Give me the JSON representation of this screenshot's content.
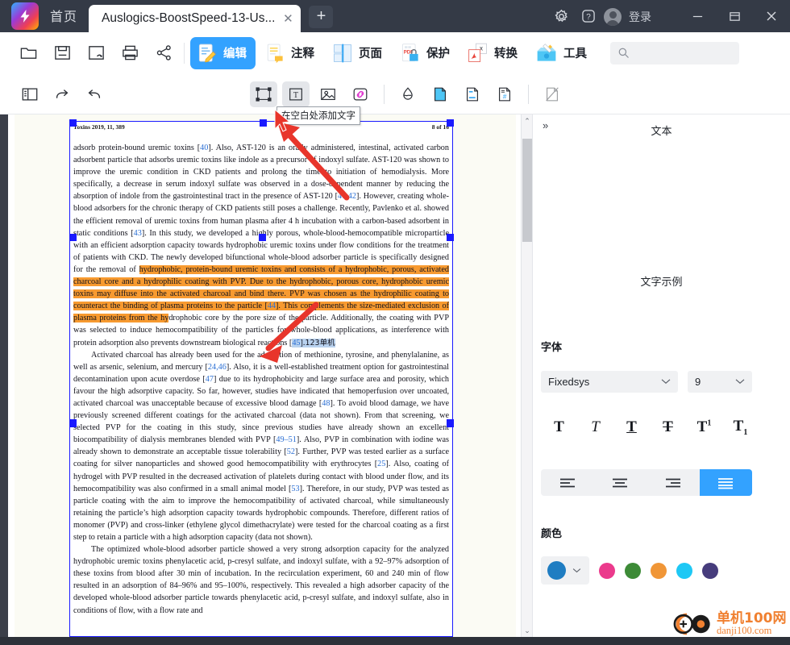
{
  "titlebar": {
    "home_tab": "首页",
    "doc_tab_title": "Auslogics-BoostSpeed-13-Us...",
    "close_tab": "✕",
    "new_tab": "+",
    "settings_icon": "gear-icon",
    "help_icon": "question-mark-icon",
    "login_label": "登录",
    "minimize": "—",
    "restore": "❐",
    "close": "✕"
  },
  "ribbon": {
    "open_label": "打开",
    "save_label": "保存",
    "saveas_label": "另存为",
    "print_label": "打印",
    "share_label": "分享",
    "modules": [
      {
        "label": "编辑",
        "icon": "edit-document-icon",
        "active": true
      },
      {
        "label": "注释",
        "icon": "annotate-document-icon",
        "active": false
      },
      {
        "label": "页面",
        "icon": "page-layout-icon",
        "active": false
      },
      {
        "label": "保护",
        "icon": "pdf-lock-icon",
        "active": false
      },
      {
        "label": "转换",
        "icon": "convert-pdf-icon",
        "active": false
      },
      {
        "label": "工具",
        "icon": "toolbox-icon",
        "active": false
      }
    ],
    "search_placeholder": "",
    "search_value": ""
  },
  "toolrow": {
    "items": [
      {
        "name": "sidebar-toggle-icon",
        "active": false
      },
      {
        "name": "redo-icon",
        "active": false
      },
      {
        "name": "undo-icon",
        "active": false
      },
      {
        "name": "select-object-icon",
        "active": true
      },
      {
        "name": "add-text-icon",
        "active": true
      },
      {
        "name": "add-image-icon",
        "active": false
      },
      {
        "name": "add-link-icon",
        "active": false
      },
      {
        "name": "watermark-icon",
        "active": false
      },
      {
        "name": "background-icon",
        "active": false
      },
      {
        "name": "header-footer-icon",
        "active": false
      },
      {
        "name": "bates-numbering-icon",
        "active": false
      },
      {
        "name": "remove-page-icon",
        "active": false
      }
    ]
  },
  "tooltip": {
    "text": "在空白处添加文字"
  },
  "document": {
    "header_left": "Toxins 2019, 11, 389",
    "header_right": "8 of 16",
    "paragraphs": [
      {
        "indent": false,
        "runs": [
          {
            "t": "adsorb protein-bound uremic toxins [",
            "s": ""
          },
          {
            "t": "40",
            "s": "ref"
          },
          {
            "t": "]. Also, AST-120 is an orally administered, intestinal, activated carbon adsorbent particle that adsorbs uremic toxins like indole as a precursor of indoxyl sulfate. AST-120 was shown to improve the uremic condition in CKD patients and prolong the time to initiation of hemodialysis. More specifically, a decrease in serum indoxyl sulfate was observed in a dose-dependent manner by reducing the absorption of indole from the gastrointestinal tract in the presence of AST-120 [",
            "s": ""
          },
          {
            "t": "41,42",
            "s": "ref"
          },
          {
            "t": "]. However, creating whole-blood adsorbers for the chronic therapy of CKD patients still poses a challenge. Recently, Pavlenko et al. showed the efficient removal of uremic toxins from human plasma after 4 h incubation with a carbon-based adsorbent in static conditions [",
            "s": ""
          },
          {
            "t": "43",
            "s": "ref"
          },
          {
            "t": "]. In this study, we developed a highly porous, whole-blood-hemocompatible microparticle with an efficient adsorption capacity towards hydrophobic uremic toxins under flow conditions for the treatment of patients with CKD. The newly developed bifunctional whole-blood adsorber particle is specifically designed for the removal of ",
            "s": ""
          },
          {
            "t": "hydrophobic, protein-bound uremic toxins and consists of a hydrophobic, porous, activated charcoal core and a hydrophilic coating with PVP. Due to the hydrophobic, porous core, hydrophobic uremic toxins may diffuse into the activated charcoal and bind there. PVP was chosen as the hydrophilic coating to counteract the binding of plasma proteins to the particle [",
            "s": "hl"
          },
          {
            "t": "44",
            "s": "hl ref"
          },
          {
            "t": "]. This complements the size-mediated exclusion of plasma proteins from the hy",
            "s": "hl"
          },
          {
            "t": "drophobic core by the pore size of the particle. Additionally, the coating with PVP was selected to induce hemocompatibility of the particles for whole-blood applications, as interference with protein adsorption also prevents downstream biological reactions [",
            "s": ""
          },
          {
            "t": "45",
            "s": "sel ref"
          },
          {
            "t": "].",
            "s": "sel"
          },
          {
            "t": "123单机",
            "s": "sel cjk"
          }
        ]
      },
      {
        "indent": true,
        "runs": [
          {
            "t": "Activated charcoal has already been used for the adsorption of methionine, tyrosine, and phenylalanine, as well as arsenic, selenium, and mercury [",
            "s": ""
          },
          {
            "t": "24,46",
            "s": "ref"
          },
          {
            "t": "]. Also, it is a well-established treatment option for gastrointestinal decontamination upon acute overdose [",
            "s": ""
          },
          {
            "t": "47",
            "s": "ref"
          },
          {
            "t": "] due to its hydrophobicity and large surface area and porosity, which favour the high adsorptive capacity. So far, however, studies have indicated that hemoperfusion over uncoated, activated charcoal was unacceptable because of excessive blood damage [",
            "s": ""
          },
          {
            "t": "48",
            "s": "ref"
          },
          {
            "t": "]. To avoid blood damage, we have previously screened different coatings for the activated charcoal (data not shown). From that screening, we selected PVP for the coating in this study, since previous studies have already shown an excellent biocompatibility of dialysis membranes blended with PVP [",
            "s": ""
          },
          {
            "t": "49–51",
            "s": "ref"
          },
          {
            "t": "]. Also, PVP in combination with iodine was already shown to demonstrate an acceptable tissue tolerability [",
            "s": ""
          },
          {
            "t": "52",
            "s": "ref"
          },
          {
            "t": "]. Further, PVP was tested earlier as a surface coating for silver nanoparticles and showed good hemocompatibility with erythrocytes [",
            "s": ""
          },
          {
            "t": "25",
            "s": "ref"
          },
          {
            "t": "]. Also, coating of hydrogel with PVP resulted in the decreased activation of platelets during contact with blood under flow, and its hemocompatibility was also confirmed in a small animal model [",
            "s": ""
          },
          {
            "t": "53",
            "s": "ref"
          },
          {
            "t": "]. Therefore, in our study, PVP was tested as particle coating with the aim to improve the hemocompatibility of activated charcoal, while simultaneously retaining the particle’s high adsorption capacity towards hydrophobic compounds. Therefore, different ratios of monomer (PVP) and cross-linker (ethylene glycol dimethacrylate) were tested for the charcoal coating as a first step to retain a particle with a high adsorption capacity (data not shown).",
            "s": ""
          }
        ]
      },
      {
        "indent": true,
        "runs": [
          {
            "t": "The optimized whole-blood adsorber particle showed a very strong adsorption capacity for the analyzed hydrophobic uremic toxins phenylacetic acid, p-cresyl sulfate, and indoxyl sulfate, with a 92–97% adsorption of these toxins from blood after 30 min of incubation. In the recirculation experiment, 60 and 240 min of flow resulted in an adsorption of 84–96% and 95–100%, respectively. This revealed a high adsorber capacity of the developed whole-blood adsorber particle towards phenylacetic acid, p-cresyl sulfate, and indoxyl sulfate, also in conditions of flow, with a flow rate and",
            "s": ""
          }
        ]
      }
    ]
  },
  "scrollbar": {
    "up": "⌃",
    "down": "⌄"
  },
  "right_panel": {
    "collapse_label": "»",
    "title": "文本",
    "sample_text": "文字示例",
    "font_section_label": "字体",
    "font_family": "Fixedsys",
    "font_size": "9",
    "style_buttons": [
      {
        "name": "bold-icon",
        "glyph": "T"
      },
      {
        "name": "italic-icon",
        "glyph": "T"
      },
      {
        "name": "underline-icon",
        "glyph": "T"
      },
      {
        "name": "strikethrough-icon",
        "glyph": "T"
      },
      {
        "name": "superscript-icon",
        "glyph": "T"
      },
      {
        "name": "subscript-icon",
        "glyph": "T"
      }
    ],
    "align_buttons": [
      {
        "name": "align-left-icon",
        "active": false
      },
      {
        "name": "align-center-icon",
        "active": false
      },
      {
        "name": "align-right-icon",
        "active": false
      },
      {
        "name": "align-justify-icon",
        "active": true
      }
    ],
    "color_section_label": "颜色",
    "current_color": "#1f7dc2",
    "palette": [
      "#eb3a8c",
      "#3d8b37",
      "#f09637",
      "#1ec8f5",
      "#463c7c"
    ]
  },
  "watermark": {
    "cn": "单机100网",
    "en": "danji100.com",
    "color": "#f08030"
  },
  "theme": {
    "titlebar_bg": "#343a46",
    "accent_blue": "#33a2ff",
    "highlight_orange": "#f79a30",
    "selection_blue": "#b9d2ef",
    "page_border": "#1a1aff",
    "arrow_red": "#e8352b"
  }
}
